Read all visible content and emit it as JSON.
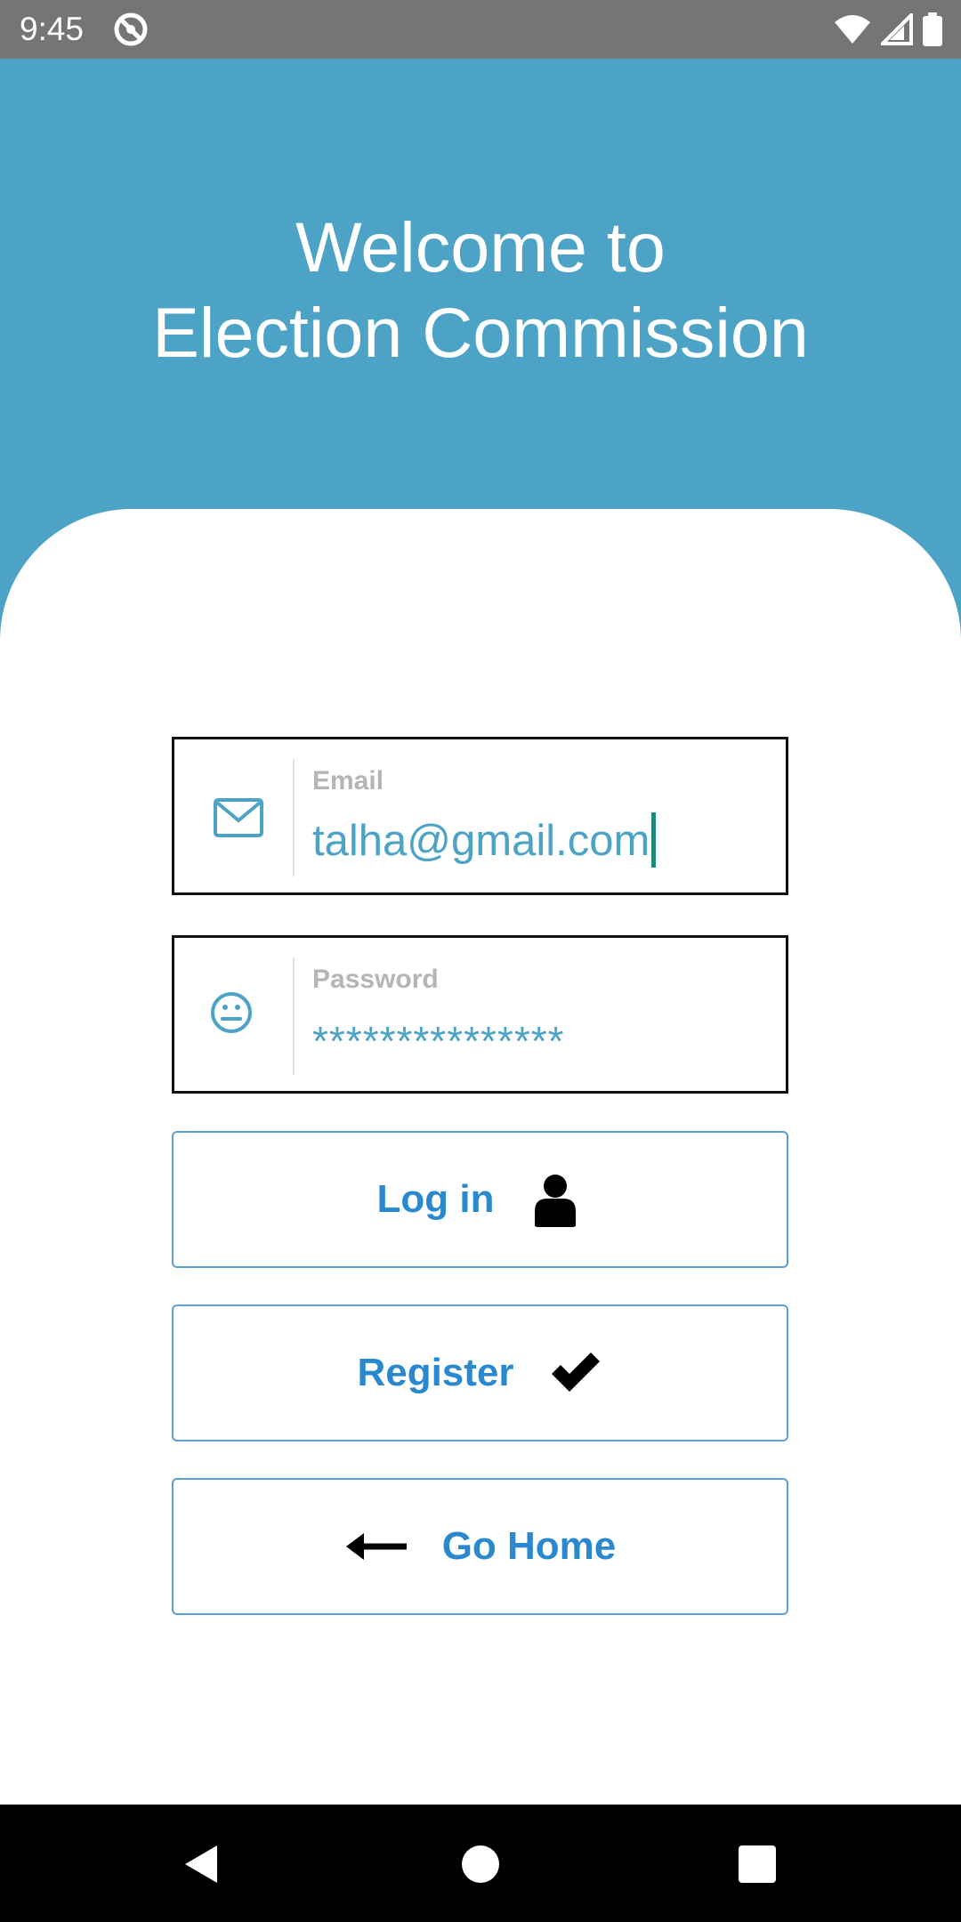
{
  "status_bar": {
    "time": "9:45",
    "icons": [
      "app-notification-icon",
      "wifi-icon",
      "cell-signal-icon",
      "battery-icon"
    ]
  },
  "header": {
    "title_line1": "Welcome to",
    "title_line2": "Election Commission",
    "background_color": "#4ca3c5"
  },
  "form": {
    "email": {
      "label": "Email",
      "value": "talha@gmail.com",
      "icon": "envelope-icon"
    },
    "password": {
      "label": "Password",
      "value": "***************",
      "icon": "neutral-face-icon"
    }
  },
  "buttons": {
    "login": {
      "label": "Log in",
      "icon": "user-icon"
    },
    "register": {
      "label": "Register",
      "icon": "checkmark-icon"
    },
    "home": {
      "label": "Go Home",
      "icon": "arrow-left-icon"
    }
  },
  "nav_bar": {
    "icons": [
      "back-triangle-icon",
      "home-circle-icon",
      "recents-square-icon"
    ]
  },
  "colors": {
    "accent": "#4ca3c5",
    "button_text": "#2a88cf",
    "button_border": "#5b9fd8",
    "status_bar": "#757575"
  }
}
